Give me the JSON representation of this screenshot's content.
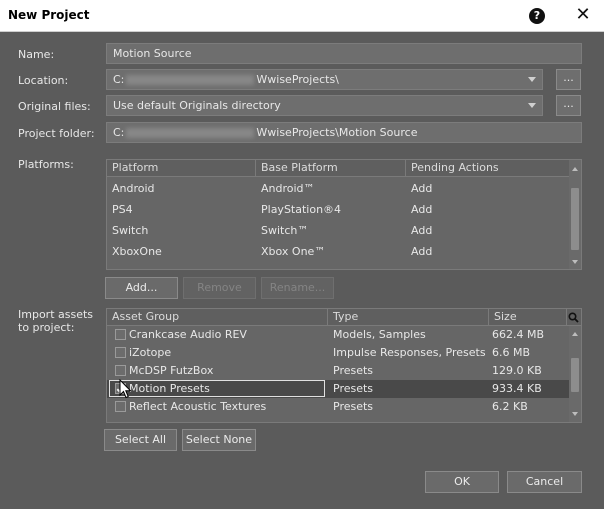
{
  "window": {
    "title": "New Project"
  },
  "name": {
    "label": "Name:",
    "value": "Motion Source"
  },
  "location": {
    "label": "Location:",
    "prefix": "C:",
    "suffix": "WwiseProjects\\",
    "browse": "..."
  },
  "original_files": {
    "label": "Original files:",
    "value": "Use default Originals directory",
    "browse": "..."
  },
  "project_folder": {
    "label": "Project folder:",
    "prefix": "C:",
    "suffix": "WwiseProjects\\Motion Source"
  },
  "platforms": {
    "label": "Platforms:",
    "columns": [
      "Platform",
      "Base Platform",
      "Pending Actions"
    ],
    "rows": [
      {
        "platform": "Android",
        "base": "Android™",
        "action": "Add"
      },
      {
        "platform": "PS4",
        "base": "PlayStation®4",
        "action": "Add"
      },
      {
        "platform": "Switch",
        "base": "Switch™",
        "action": "Add"
      },
      {
        "platform": "XboxOne",
        "base": "Xbox One™",
        "action": "Add"
      }
    ],
    "buttons": {
      "add": "Add...",
      "remove": "Remove",
      "rename": "Rename..."
    }
  },
  "import": {
    "label": "Import assets to project:",
    "columns": [
      "Asset Group",
      "Type",
      "Size"
    ],
    "rows": [
      {
        "group": "Crankcase Audio REV",
        "type": "Models, Samples",
        "size": "662.4 MB",
        "checked": false
      },
      {
        "group": "iZotope",
        "type": "Impulse Responses, Presets",
        "size": "6.6 MB",
        "checked": false
      },
      {
        "group": "McDSP FutzBox",
        "type": "Presets",
        "size": "129.0 KB",
        "checked": false
      },
      {
        "group": "Motion Presets",
        "type": "Presets",
        "size": "933.4 KB",
        "checked": true
      },
      {
        "group": "Reflect Acoustic Textures",
        "type": "Presets",
        "size": "6.2 KB",
        "checked": false
      }
    ],
    "buttons": {
      "select_all": "Select All",
      "select_none": "Select None"
    }
  },
  "footer": {
    "ok": "OK",
    "cancel": "Cancel"
  },
  "icons": {
    "help": "help-icon",
    "close": "close-icon",
    "search": "search-icon",
    "cursor": "mouse-pointer-icon"
  },
  "colors": {
    "background": "#5b5b5b",
    "field": "#6e6e6e",
    "selected_row": "#494949",
    "titlebar": "#ffffff"
  }
}
